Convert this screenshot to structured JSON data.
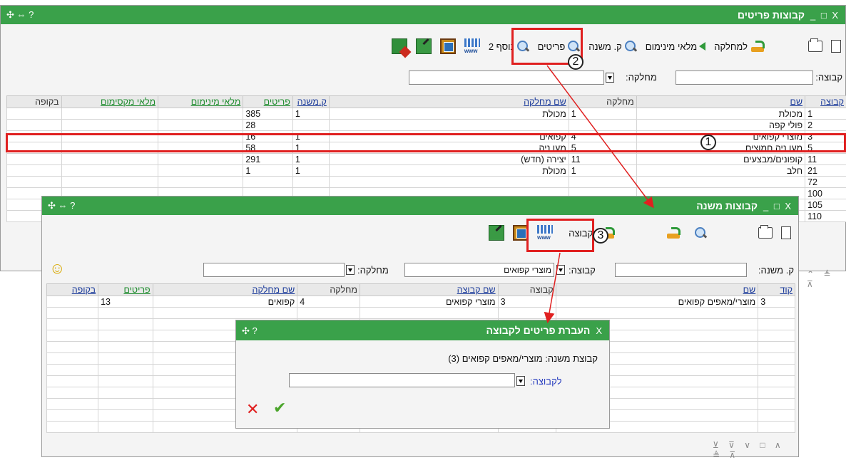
{
  "colors": {
    "titlebar": "#3aa14a",
    "link": "#1a8a2a",
    "callout": "#e02020"
  },
  "win1": {
    "title": "קבוצות פריטים",
    "controls": "X □ _",
    "left_icons": "? ⇔ ✣",
    "toolbar": {
      "to_department": "למחלקה",
      "min_stock": "מלאי מינימום",
      "subgroup": "ק. משנה",
      "items": "פריטים",
      "extra2": "נוסף 2"
    },
    "filters": {
      "group_label": "קבוצה:",
      "department_label": "מחלקה:"
    },
    "table": {
      "headers": [
        "קבוצה",
        "שם",
        "מחלקה",
        "שם מחלקה",
        "ק.משנה",
        "פריטים",
        "מלאי מינימום",
        "מלאי מקסימום",
        "בקופה"
      ],
      "rows": [
        [
          "1",
          "מכולת",
          "1",
          "מכולת",
          "1",
          "385",
          "",
          "",
          ""
        ],
        [
          "2",
          "פולי קפה",
          "",
          "",
          "",
          "28",
          "",
          "",
          ""
        ],
        [
          "3",
          "מוצרי קפואים",
          "4",
          "קפואים",
          "1",
          "16",
          "",
          "",
          ""
        ],
        [
          "5",
          "מעו ניה חמוצים",
          "5",
          "מעו ניה",
          "1",
          "58",
          "",
          "",
          ""
        ],
        [
          "11",
          "קופונים/מבצעים",
          "11",
          "יצירה (חדש)",
          "1",
          "291",
          "",
          "",
          ""
        ],
        [
          "21",
          "חלב",
          "1",
          "מכולת",
          "1",
          "1",
          "",
          "",
          ""
        ],
        [
          "72",
          "",
          "",
          "",
          "",
          "",
          "",
          "",
          ""
        ],
        [
          "100",
          "",
          "",
          "",
          "",
          "",
          "",
          "",
          ""
        ],
        [
          "105",
          "",
          "",
          "",
          "",
          "",
          "",
          "",
          ""
        ],
        [
          "110",
          "",
          "",
          "",
          "",
          "",
          "",
          "",
          ""
        ]
      ]
    },
    "footer": "⌃ ≜ ⊼"
  },
  "win2": {
    "title": "קבוצות משנה",
    "controls": "X □ _",
    "left_icons": "? ⇔ ✣",
    "toolbar": {
      "to_group": "לקבוצה"
    },
    "filters": {
      "subgroup_label": "ק. משנה:",
      "group_label": "קבוצה:",
      "group_value": "מוצרי קפואים",
      "department_label": "מחלקה:"
    },
    "smiley": "☺",
    "table": {
      "headers": [
        "קוד",
        "שם",
        "קבוצה",
        "שם קבוצה",
        "מחלקה",
        "שם מחלקה",
        "פריטים",
        "בקופה"
      ],
      "rows": [
        [
          "3",
          "מוצרי/מאפים קפואים",
          "3",
          "מוצרי קפואים",
          "4",
          "קפואים",
          "13",
          ""
        ]
      ]
    },
    "footer": "⊻ ⊽ ∨ □ ∧ ≜ ⊼"
  },
  "dialog": {
    "title": "העברת פריטים לקבוצה",
    "close": "X",
    "left_icons": "? ✣",
    "subgroup_text": "קבוצת משנה: מוצרי/מאפים קפואים (3)",
    "to_group_label": "לקבוצה:",
    "cancel_glyph": "✕",
    "ok_glyph": "✔"
  },
  "callouts": {
    "one": "1",
    "two": "2",
    "three": "3"
  }
}
